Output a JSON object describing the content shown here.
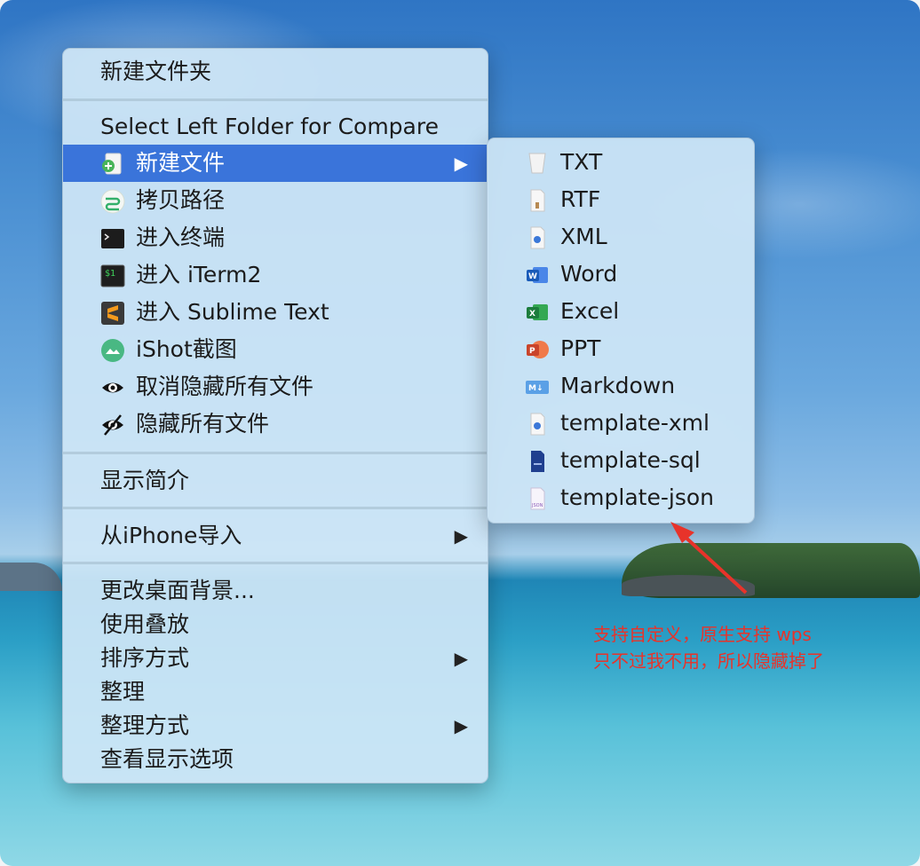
{
  "main_menu": {
    "items": [
      {
        "label": "新建文件夹"
      },
      {
        "label": "Select Left Folder for Compare"
      },
      {
        "label": "新建文件",
        "arrow": "▶"
      },
      {
        "label": "拷贝路径"
      },
      {
        "label": "进入终端"
      },
      {
        "label": "进入 iTerm2"
      },
      {
        "label": "进入 Sublime Text"
      },
      {
        "label": "iShot截图"
      },
      {
        "label": "取消隐藏所有文件"
      },
      {
        "label": "隐藏所有文件"
      },
      {
        "label": "显示简介"
      },
      {
        "label": "从iPhone导入",
        "arrow": "▶"
      },
      {
        "label": "更改桌面背景..."
      },
      {
        "label": "使用叠放"
      },
      {
        "label": "排序方式",
        "arrow": "▶"
      },
      {
        "label": "整理"
      },
      {
        "label": "整理方式",
        "arrow": "▶"
      },
      {
        "label": "查看显示选项"
      }
    ]
  },
  "sub_menu": {
    "items": [
      {
        "label": "TXT"
      },
      {
        "label": "RTF"
      },
      {
        "label": "XML"
      },
      {
        "label": "Word"
      },
      {
        "label": "Excel"
      },
      {
        "label": "PPT"
      },
      {
        "label": "Markdown"
      },
      {
        "label": "template-xml"
      },
      {
        "label": "template-sql"
      },
      {
        "label": "template-json"
      }
    ]
  },
  "annotation": {
    "line1": "支持自定义，原生支持 wps",
    "line2": "只不过我不用，所以隐藏掉了"
  },
  "icon_text": {
    "iterm": "$1",
    "markdown": "M↓",
    "word": "W",
    "excel": "X",
    "ppt": "P",
    "json": "JSON"
  },
  "colors": {
    "selection": "#3a74da",
    "annotation": "#e8332a"
  }
}
